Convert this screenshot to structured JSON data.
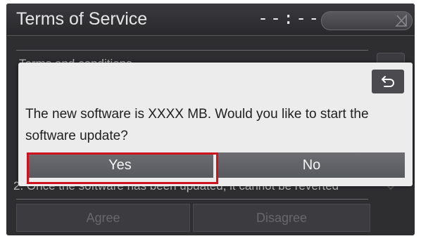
{
  "header": {
    "title": "Terms of Service",
    "clock": "--:--"
  },
  "background": {
    "section_heading": "Terms and conditions",
    "term_line": "2. Once the software has been updated, it cannot be reverted",
    "agree_label": "Agree",
    "disagree_label": "Disagree"
  },
  "dialog": {
    "message": "The new software is XXXX MB. Would you like to start the software update?",
    "yes_label": "Yes",
    "no_label": "No",
    "back_icon": "return-arrow-icon"
  },
  "colors": {
    "highlight": "#d0111e",
    "dialog_bg": "#ececec",
    "screen_bg": "#2e2e31"
  }
}
